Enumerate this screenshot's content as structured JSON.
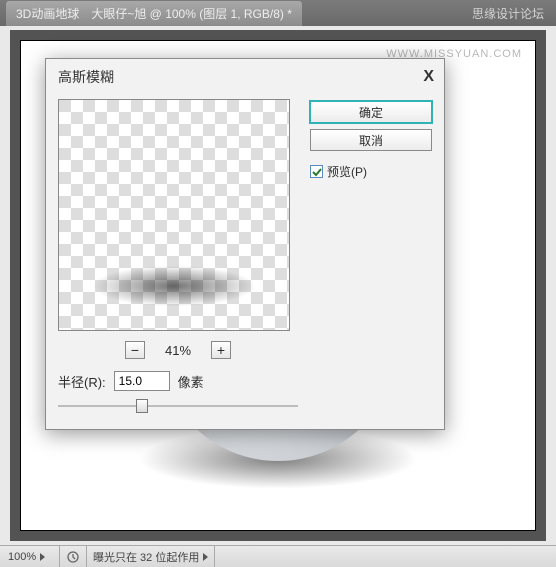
{
  "tabbar": {
    "document_title": "3D动画地球　大眼仔~旭 @ 100% (图层 1, RGB/8) *",
    "brand": "思缘设计论坛"
  },
  "watermark": "WWW.MISSYUAN.COM",
  "dialog": {
    "title": "高斯模糊",
    "close_icon": "X",
    "zoom_minus": "−",
    "zoom_plus": "+",
    "zoom_level": "41%",
    "radius_label": "半径(R):",
    "radius_value": "15.0",
    "radius_unit": "像素",
    "ok_label": "确定",
    "cancel_label": "取消",
    "preview_label": "预览(P)"
  },
  "status": {
    "zoom": "100%",
    "message": "曝光只在 32 位起作用"
  }
}
